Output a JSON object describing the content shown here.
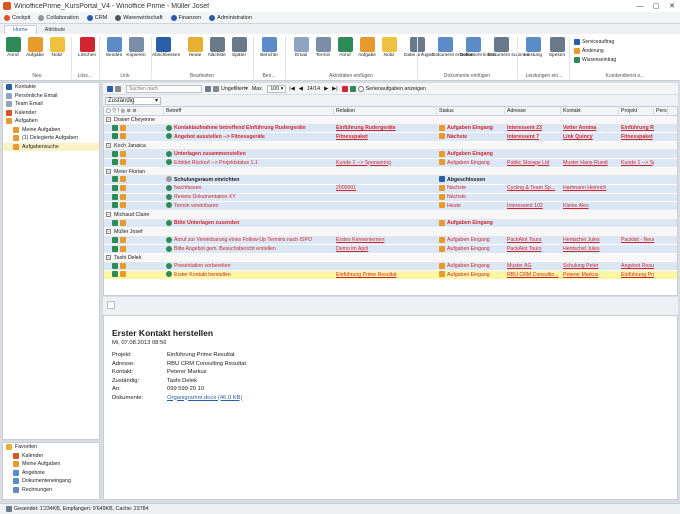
{
  "window": {
    "title": "WinofficePrime_KursPortal_V4 - Winoffice Prime - Müller Josef",
    "min": "—",
    "max": "▢",
    "close": "✕"
  },
  "apps": [
    {
      "label": "Cockpit",
      "color": "#d9541e"
    },
    {
      "label": "Collaboration",
      "color": "#999999"
    },
    {
      "label": "CRM",
      "color": "#2a5ea8"
    },
    {
      "label": "Warenwirtschaft",
      "color": "#555555"
    },
    {
      "label": "Finanzen",
      "color": "#2a5ea8"
    },
    {
      "label": "Administration",
      "color": "#2a5ea8"
    }
  ],
  "ribbon_tabs": [
    "Home",
    "Attribute"
  ],
  "ribbon": {
    "buttons": [
      {
        "label": "Anruf",
        "color": "#2e8b57"
      },
      {
        "label": "Aufgabe",
        "color": "#e79b2f"
      },
      {
        "label": "Notiz",
        "color": "#f0c040"
      },
      {
        "label": "Löschen",
        "color": "#d1242f"
      },
      {
        "label": "Senden",
        "color": "#5b8cc8"
      },
      {
        "label": "Kopieren",
        "color": "#7a8ea8"
      },
      {
        "label": "Abschliessen",
        "color": "#2a5ea8"
      },
      {
        "label": "Heute",
        "color": "#e8b030"
      },
      {
        "label": "Nächste",
        "color": "#6a7a8a"
      },
      {
        "label": "Später",
        "color": "#6a7a8a"
      },
      {
        "label": "Berichte",
        "color": "#5b8cc8"
      },
      {
        "label": "Email",
        "color": "#8ea4c0"
      },
      {
        "label": "Termin",
        "color": "#7a8ea8"
      },
      {
        "label": "Anruf",
        "color": "#2e8b57"
      },
      {
        "label": "Aufgabe",
        "color": "#e79b2f"
      },
      {
        "label": "Notiz",
        "color": "#f0c040"
      },
      {
        "label": "Datei anfügen",
        "color": "#6a7a8a"
      },
      {
        "label": "Dokument erstellen",
        "color": "#5b8cc8"
      },
      {
        "label": "Dokument linken",
        "color": "#5b8cc8"
      },
      {
        "label": "Dokument scannen",
        "color": "#6a7a8a"
      },
      {
        "label": "Leistung",
        "color": "#5b8cc8"
      },
      {
        "label": "Spesen",
        "color": "#6a7a8a"
      }
    ],
    "groups": [
      "Neu",
      "Lösc...",
      "Link",
      "Bearbeiten",
      "Beri...",
      "Aktivitäten einfügen",
      "Dokumente einfügen",
      "Leistungen ein...",
      "Kundendienst e..."
    ],
    "side_buttons": [
      "Serviceauftrag",
      "Änderung",
      "Wissenseintrag"
    ]
  },
  "sidebar": {
    "items": [
      "Kontakte",
      "Persönliche Email",
      "Team Email",
      "Kalender",
      "Aufgaben",
      "Meine Aufgaben",
      "(1) Delegierte Aufgaben",
      "Aufgabensuche"
    ],
    "favorites_title": "Favoriten",
    "favorites": [
      "Kalender",
      "Meine Aufgaben",
      "Angebote",
      "Dokumenteneingang",
      "Rechnungen"
    ]
  },
  "toolbar": {
    "search_placeholder": "Suchen nach",
    "filter": "Ungefiltert",
    "max_label": "Max.",
    "max_value": "100",
    "pager": "14/14",
    "serial": "Serienaufgaben anzeigen"
  },
  "groupby": "Zuständig",
  "columns": [
    "Betreff",
    "Relation",
    "Status",
    "Adresse",
    "Kontakt",
    "Projekt",
    "Pers"
  ],
  "groups": [
    {
      "name": "Dosier Cheyenne",
      "rows": [
        {
          "subject": "Kontaktaufnahme betreffend Einführung Rudergeräte",
          "relation": "Einführung Rudergeräte",
          "status": "Aufgaben Eingang",
          "address": "Interessent 23",
          "contact": "Vetter Annina",
          "project": "Einführung Rude...",
          "bold": true
        },
        {
          "subject": "Angebot ausstellen --> Fitnessgeräte",
          "relation": "Fitnesspaket",
          "status": "Nächste",
          "address": "Interessent 7",
          "contact": "Link Quincy",
          "project": "Fitnesspaket",
          "bold": true
        }
      ]
    },
    {
      "name": "Koch Janaica",
      "rows": [
        {
          "subject": "Unterlagen zusammenstellen",
          "relation": "",
          "status": "Aufgaben Eingang",
          "address": "",
          "contact": "",
          "project": "",
          "bold": true
        },
        {
          "subject": "Erbittet Rückruf --> Projektstatus 1.1",
          "relation": "Kunde 1 --> Sponsoring",
          "status": "Aufgaben Eingang",
          "address": "Public Storage Ltd",
          "contact": "Muster Hans-Ruedi",
          "project": "Kunde 1 --> Spons...",
          "bold": false
        }
      ]
    },
    {
      "name": "Meier Florian",
      "rows": [
        {
          "subject": "Schulungsraum einrichten",
          "relation": "",
          "status": "Abgeschlossen",
          "address": "",
          "contact": "",
          "project": "",
          "bold": true,
          "grey": true
        },
        {
          "subject": "Nachfassen",
          "relation": "2000001",
          "status": "Nächste",
          "address": "Cycling & Team Sp...",
          "contact": "Hartmann Heinrich",
          "project": "",
          "bold": false
        },
        {
          "subject": "Review Dokumentation XY",
          "relation": "",
          "status": "Nächste",
          "address": "",
          "contact": "",
          "project": "",
          "bold": false
        },
        {
          "subject": "Termin vereinbaren",
          "relation": "",
          "status": "Heute",
          "address": "Interessent 102",
          "contact": "Kleine Alex",
          "project": "",
          "bold": false
        }
      ]
    },
    {
      "name": "Michaud Claire",
      "rows": [
        {
          "subject": "Bitte Unterlagen zusenden",
          "relation": "",
          "status": "Aufgaben Eingang",
          "address": "",
          "contact": "",
          "project": "",
          "bold": true
        }
      ]
    },
    {
      "name": "Müller Josef",
      "rows": [
        {
          "subject": "Anruf zur Vereinbarung eines Follow-Up Termins nach ISPO",
          "relation": "Erstes Kennenlernen",
          "status": "Aufgaben Eingang",
          "address": "PackAlot Tours",
          "contact": "Hentschel Jules",
          "project": "Packlist - Neue Ver...",
          "bold": false
        },
        {
          "subject": "Bitte Angebot gem. Besuchsbericht erstellen",
          "relation": "Demo im April",
          "status": "Aufgaben Eingang",
          "address": "PackAlot Tours",
          "contact": "Hentschel Jules",
          "project": "",
          "bold": false
        }
      ]
    },
    {
      "name": "Tashi Delek",
      "rows": [
        {
          "subject": "Presentation vorbereiten",
          "relation": "",
          "status": "Aufgaben Eingang",
          "address": "Muster AG",
          "contact": "Schulung Peter",
          "project": "Angebot Resultat",
          "bold": false
        },
        {
          "subject": "Erster Kontakt herstellen",
          "relation": "Einführung Prime Resultat",
          "status": "Aufgaben Eingang",
          "address": "RBU CRM Consultin...",
          "contact": "Peterer Markus",
          "project": "Einführung Prime R...",
          "bold": false,
          "highlight": true
        }
      ]
    }
  ],
  "detail": {
    "title": "Erster Kontakt herstellen",
    "date": "Mi, 07.08.2013 08:56",
    "fields": [
      {
        "k": "Projekt:",
        "v": "Einführung Prime Resultat"
      },
      {
        "k": "Adresse:",
        "v": "RBU CRM Consulting Resultat"
      },
      {
        "k": "Kontakt:",
        "v": "Peterer Markus"
      },
      {
        "k": "Zuständig:",
        "v": "Tashi Delek"
      },
      {
        "k": "An:",
        "v": "099 599 20 10"
      },
      {
        "k": "Dokumente:",
        "v": "Organigramm.docx (46.0 KB)"
      }
    ]
  },
  "status": "Gesendet: 1'234KB, Empfangen: 9'649KB, Cache: 23784"
}
